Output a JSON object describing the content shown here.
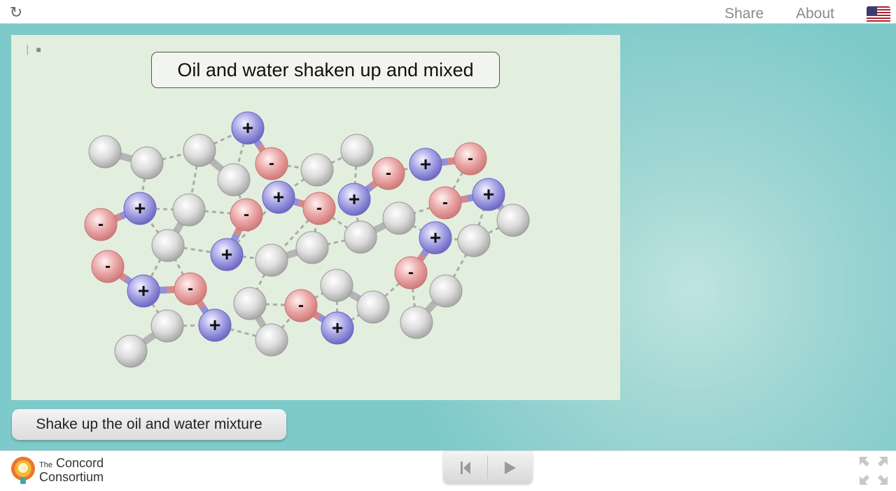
{
  "header": {
    "share_label": "Share",
    "about_label": "About",
    "reload_icon": "reload-icon",
    "language_flag": "us-flag-icon"
  },
  "sim": {
    "title": "Oil and water shaken up and mixed",
    "plus_symbol": "+",
    "minus_symbol": "-",
    "colors": {
      "background": "#e3efde",
      "neutral_atom": "#d9d9d9",
      "positive_atom": "#8c89d6",
      "negative_atom": "#e39494"
    }
  },
  "controls": {
    "shake_button_label": "Shake up the oil and water mixture"
  },
  "footer": {
    "logo_the": "The",
    "logo_line1": "Concord",
    "logo_line2": "Consortium"
  }
}
